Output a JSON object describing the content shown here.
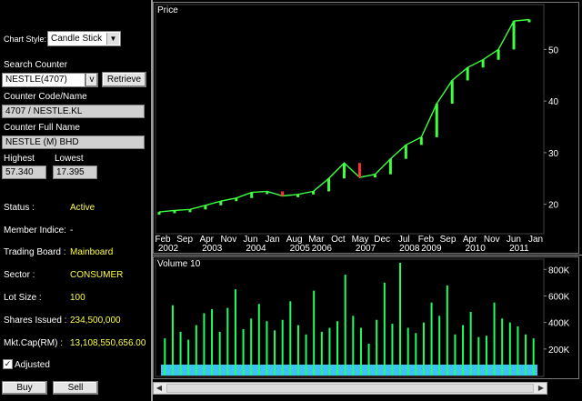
{
  "chart_style": {
    "label": "Chart Style:",
    "value": "Candle Stick",
    "options": [
      "Candle Stick"
    ]
  },
  "search": {
    "label": "Search Counter",
    "value": "NESTLE(4707)",
    "dropdown_glyph": "v",
    "retrieve_label": "Retrieve"
  },
  "counter_code": {
    "label": "Counter Code/Name",
    "value": "4707 / NESTLE.KL"
  },
  "counter_full": {
    "label": "Counter Full Name",
    "value": "NESTLE (M) BHD"
  },
  "highest": {
    "label": "Highest",
    "value": "57.340"
  },
  "lowest": {
    "label": "Lowest",
    "value": "17.395"
  },
  "info": [
    {
      "label": "Status :",
      "value": "Active"
    },
    {
      "label": "Member Indice:",
      "value": "-"
    },
    {
      "label": "Trading Board :",
      "value": "Mainboard"
    },
    {
      "label": "Sector :",
      "value": "CONSUMER"
    },
    {
      "label": "Lot Size :",
      "value": "100"
    },
    {
      "label": "Shares Issued :",
      "value": "234,500,000"
    },
    {
      "label": "Mkt.Cap(RM) :",
      "value": "13,108,550,656.00"
    }
  ],
  "adjusted": {
    "label": "Adjusted",
    "checked": true
  },
  "actions": {
    "buy": "Buy",
    "sell": "Sell"
  },
  "colors": {
    "price": "#40ff40",
    "price_down": "#ff3030",
    "volume": "#20ff60",
    "volume_base": "#40c0ff",
    "value_text": "#ffff40"
  },
  "chart_data": [
    {
      "type": "line",
      "title": "Price",
      "x_labels": [
        {
          "month": "Feb",
          "year": "2002"
        },
        {
          "month": "Sep",
          "year": ""
        },
        {
          "month": "Apr",
          "year": "2003"
        },
        {
          "month": "Nov",
          "year": ""
        },
        {
          "month": "Jun",
          "year": "2004"
        },
        {
          "month": "Jan",
          "year": ""
        },
        {
          "month": "Aug",
          "year": "2005"
        },
        {
          "month": "Mar",
          "year": "2006"
        },
        {
          "month": "Oct",
          "year": ""
        },
        {
          "month": "May",
          "year": "2007"
        },
        {
          "month": "Dec",
          "year": ""
        },
        {
          "month": "Jul",
          "year": "2008"
        },
        {
          "month": "Feb",
          "year": "2009"
        },
        {
          "month": "Sep",
          "year": ""
        },
        {
          "month": "Apr",
          "year": "2010"
        },
        {
          "month": "Nov",
          "year": ""
        },
        {
          "month": "Jun",
          "year": "2011"
        },
        {
          "month": "Jan",
          "year": ""
        }
      ],
      "y_ticks": [
        20,
        30,
        40,
        50
      ],
      "ylim": [
        15,
        58
      ],
      "x": [
        "2002-02",
        "2002-09",
        "2003-04",
        "2003-11",
        "2004-06",
        "2005-01",
        "2005-08",
        "2006-03",
        "2006-10",
        "2007-05",
        "2007-12",
        "2008-04",
        "2008-07",
        "2008-10",
        "2009-02",
        "2009-09",
        "2010-01",
        "2010-04",
        "2010-08",
        "2010-11",
        "2011-02",
        "2011-06",
        "2011-09",
        "2011-12",
        "2012-02"
      ],
      "values": [
        18.5,
        18.8,
        19.0,
        19.8,
        20.6,
        21.2,
        22.3,
        22.5,
        21.6,
        21.9,
        22.5,
        25.0,
        28.0,
        25.2,
        25.8,
        28.8,
        31.5,
        33.0,
        39.5,
        44.0,
        46.5,
        48.0,
        50.0,
        55.5,
        55.8
      ]
    },
    {
      "type": "bar",
      "title": "Volume 10",
      "y_ticks": [
        "200K",
        "400K",
        "600K",
        "800K"
      ],
      "y_tick_values": [
        200000,
        400000,
        600000,
        800000
      ],
      "ylim": [
        0,
        850000
      ],
      "values": [
        280000,
        530000,
        330000,
        270000,
        380000,
        470000,
        500000,
        330000,
        510000,
        650000,
        350000,
        430000,
        540000,
        410000,
        340000,
        420000,
        560000,
        380000,
        310000,
        640000,
        330000,
        360000,
        410000,
        760000,
        450000,
        360000,
        240000,
        420000,
        700000,
        390000,
        850000,
        360000,
        320000,
        400000,
        550000,
        450000,
        680000,
        310000,
        380000,
        480000,
        290000,
        300000,
        550000,
        430000,
        400000,
        370000,
        310000,
        280000
      ]
    }
  ]
}
